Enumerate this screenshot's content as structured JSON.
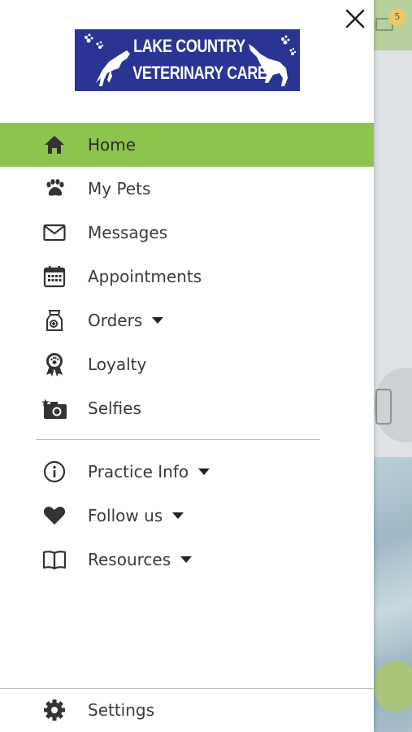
{
  "app": {
    "logo_line1": "LAKE COUNTRY",
    "logo_line2": "VETERINARY CARE",
    "brand_color": "#2a3593",
    "accent_color": "#8cc44e"
  },
  "background": {
    "notification_count": "5"
  },
  "menu": {
    "primary": [
      {
        "label": "Home",
        "icon": "home-icon",
        "active": true
      },
      {
        "label": "My Pets",
        "icon": "paw-icon"
      },
      {
        "label": "Messages",
        "icon": "mail-icon"
      },
      {
        "label": "Appointments",
        "icon": "calendar-icon"
      },
      {
        "label": "Orders",
        "icon": "food-bag-icon",
        "dropdown": true
      },
      {
        "label": "Loyalty",
        "icon": "award-ribbon-icon"
      },
      {
        "label": "Selfies",
        "icon": "camera-icon"
      }
    ],
    "secondary": [
      {
        "label": "Practice Info",
        "icon": "info-icon",
        "dropdown": true
      },
      {
        "label": "Follow us",
        "icon": "heart-icon",
        "dropdown": true
      },
      {
        "label": "Resources",
        "icon": "book-icon",
        "dropdown": true
      }
    ],
    "settings": {
      "label": "Settings",
      "icon": "gear-icon"
    }
  }
}
